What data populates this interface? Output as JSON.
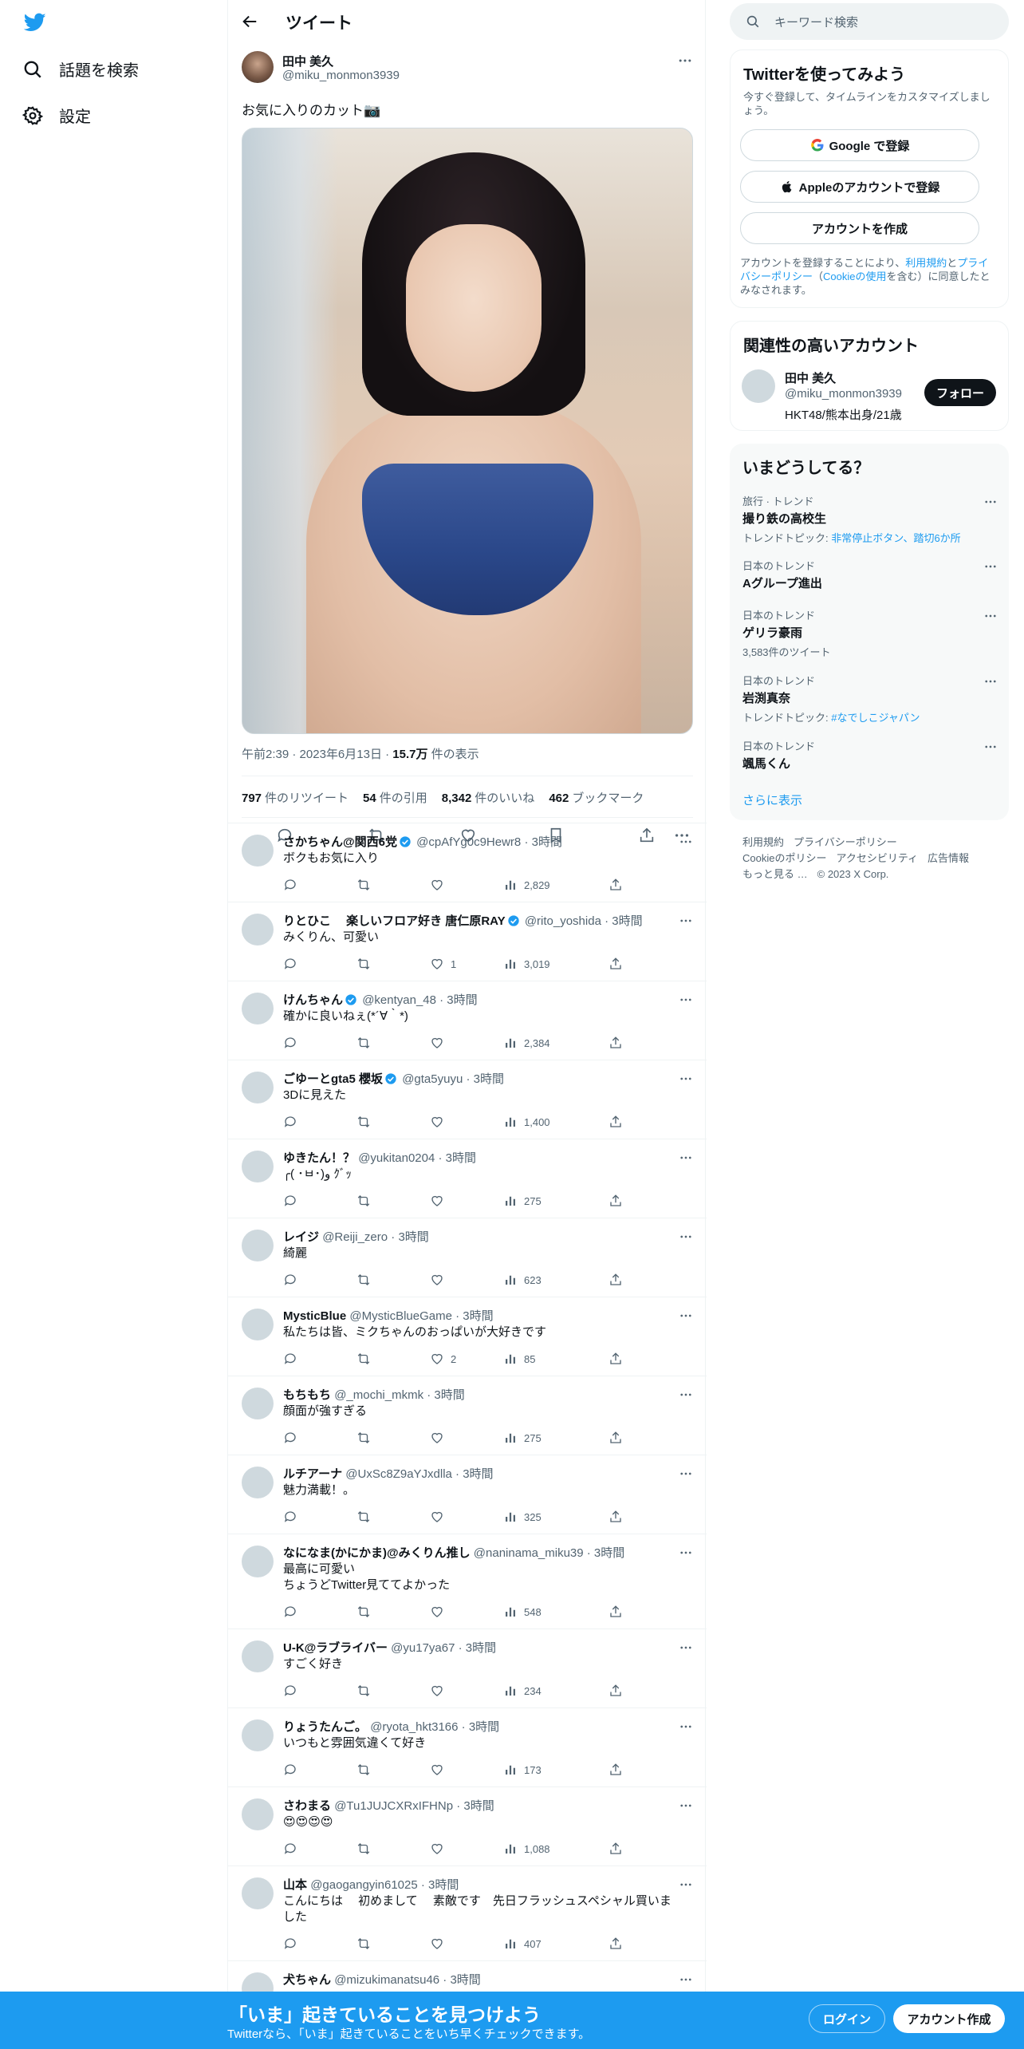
{
  "nav": {
    "search_label": "話題を検索",
    "settings_label": "設定"
  },
  "topbar": {
    "title": "ツイート"
  },
  "tweet": {
    "author_name": "田中 美久",
    "author_handle": "@miku_monmon3939",
    "text": "お気に入りのカット📷",
    "time": "午前2:39",
    "date": "2023年6月13日",
    "views_count": "15.7万",
    "views_label": "件の表示",
    "retweets_count": "797",
    "retweets_label": "件のリツイート",
    "quotes_count": "54",
    "quotes_label": "件の引用",
    "likes_count": "8,342",
    "likes_label": "件のいいね",
    "bookmarks_count": "462",
    "bookmarks_label": "ブックマーク"
  },
  "replies": [
    {
      "name": "さかちゃん@関西6党",
      "verified": true,
      "handle": "@cpAfYg0c9Hewr8 · 3時間",
      "text": "ボクもお気に入り",
      "likes": "",
      "views": "2,829"
    },
    {
      "name": "りとひこ　 楽しいフロア好き 唐仁原RAY",
      "verified": true,
      "handle": "@rito_yoshida · 3時間",
      "text": "みくりん、可愛い",
      "likes": "1",
      "views": "3,019"
    },
    {
      "name": "けんちゃん",
      "verified": true,
      "handle": "@kentyan_48 · 3時間",
      "text": "確かに良いねぇ(*´∀｀*)",
      "likes": "",
      "views": "2,384"
    },
    {
      "name": "ごゆーとgta5 櫻坂",
      "verified": true,
      "handle": "@gta5yuyu · 3時間",
      "text": "3Dに見えた",
      "likes": "",
      "views": "1,400"
    },
    {
      "name": "ゆきたん！？",
      "verified": false,
      "handle": "@yukitan0204 · 3時間",
      "text": "╭( ･ㅂ･)و ｸﾞｯ",
      "likes": "",
      "views": "275"
    },
    {
      "name": "レイジ",
      "verified": false,
      "handle": "@Reiji_zero · 3時間",
      "text": "綺麗",
      "likes": "",
      "views": "623"
    },
    {
      "name": "MysticBlue",
      "verified": false,
      "handle": "@MysticBlueGame · 3時間",
      "text": "私たちは皆、ミクちゃんのおっぱいが大好きです",
      "likes": "2",
      "views": "85"
    },
    {
      "name": "もちもち",
      "verified": false,
      "handle": "@_mochi_mkmk · 3時間",
      "text": "顔面が強すぎる",
      "likes": "",
      "views": "275"
    },
    {
      "name": "ルチアーナ",
      "verified": false,
      "handle": "@UxSc8Z9aYJxdlla · 3時間",
      "text": "魅力満載！。",
      "likes": "",
      "views": "325"
    },
    {
      "name": "なになま(かにかま)@みくりん推し",
      "verified": false,
      "handle": "@naninama_miku39 · 3時間",
      "text": "最高に可愛い\nちょうどTwitter見ててよかった",
      "likes": "",
      "views": "548"
    },
    {
      "name": "U-K@ラブライバー",
      "verified": false,
      "handle": "@yu17ya67 · 3時間",
      "text": "すごく好き",
      "likes": "",
      "views": "234"
    },
    {
      "name": "りょうたんご。",
      "verified": false,
      "handle": "@ryota_hkt3166 · 3時間",
      "text": "いつもと雰囲気違くて好き",
      "likes": "",
      "views": "173"
    },
    {
      "name": "さわまる",
      "verified": false,
      "handle": "@Tu1JUJCXRxIFHNp · 3時間",
      "text": "😍😍😍😍",
      "likes": "",
      "views": "1,088"
    },
    {
      "name": "山本",
      "verified": false,
      "handle": "@gaogangyin61025 · 3時間",
      "text": "こんにちは　 初めまして　 素敵です　先日フラッシュスペシャル買いました",
      "likes": "",
      "views": "407"
    },
    {
      "name": "犬ちゃん",
      "verified": false,
      "handle": "@mizukimanatsu46 · 3時間",
      "text": "",
      "likes": "",
      "views": ""
    }
  ],
  "sidebar": {
    "search_placeholder": "キーワード検索",
    "signup_card": {
      "title": "Twitterを使ってみよう",
      "subtitle": "今すぐ登録して、タイムラインをカスタマイズしましょう。",
      "google_button": "Google で登録",
      "apple_button": "Appleのアカウントで登録",
      "create_button": "アカウントを作成",
      "terms_1": "アカウントを登録することにより、",
      "terms_link1": "利用規約",
      "terms_2": "と",
      "terms_link2": "プライバシーポリシー",
      "terms_3": "（",
      "terms_link3": "Cookieの使用",
      "terms_4": "を含む）に同意したとみなされます。"
    },
    "related_card": {
      "title": "関連性の高いアカウント",
      "name": "田中 美久",
      "handle": "@miku_monmon3939",
      "bio": "HKT48/熊本出身/21歳",
      "follow_button": "フォロー"
    },
    "trends_card": {
      "title": "いまどうしてる？",
      "trends": [
        {
          "category": "旅行 · トレンド",
          "name": "撮り鉄の高校生",
          "sub_prefix": "トレンドトピック: ",
          "sub_links": "非常停止ボタン、踏切6か所"
        },
        {
          "category": "日本のトレンド",
          "name": "Aグループ進出",
          "sub_prefix": "",
          "sub_links": ""
        },
        {
          "category": "日本のトレンド",
          "name": "ゲリラ豪雨",
          "sub_prefix": "3,583件のツイート",
          "sub_links": ""
        },
        {
          "category": "日本のトレンド",
          "name": "岩渕真奈",
          "sub_prefix": "トレンドトピック: ",
          "sub_links": "#なでしこジャパン"
        },
        {
          "category": "日本のトレンド",
          "name": "颯馬くん",
          "sub_prefix": "",
          "sub_links": ""
        }
      ],
      "show_more": "さらに表示"
    },
    "footer": {
      "links_line1": [
        "利用規約",
        "プライバシーポリシー"
      ],
      "links_line2": [
        "Cookieのポリシー",
        "アクセシビリティ",
        "広告情報"
      ],
      "more": "もっと見る …",
      "copyright": "© 2023 X Corp."
    }
  },
  "bottom_bar": {
    "title": "「いま」起きていることを見つけよう",
    "subtitle": "Twitterなら、「いま」起きていることをいち早くチェックできます。",
    "login": "ログイン",
    "signup": "アカウント作成"
  },
  "colors": {
    "accent": "#1d9bf0",
    "text": "#0f1419",
    "secondary": "#536471"
  }
}
